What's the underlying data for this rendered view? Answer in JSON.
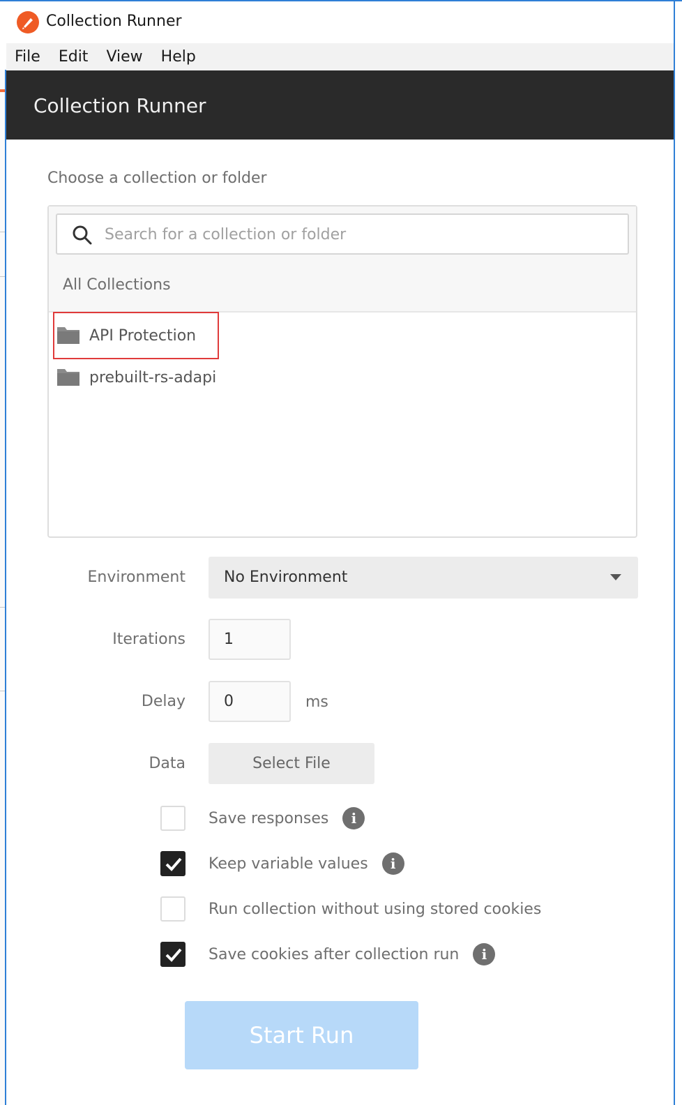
{
  "window": {
    "title": "Collection Runner",
    "icon": "postman-rocket-icon",
    "accent_color": "#ef5b25",
    "border_color": "#2f7fd6"
  },
  "menubar": {
    "items": [
      "File",
      "Edit",
      "View",
      "Help"
    ]
  },
  "header": {
    "title": "Collection Runner",
    "background": "#2a2a2a"
  },
  "chooser": {
    "label": "Choose a collection or folder",
    "search_placeholder": "Search for a collection or folder",
    "search_value": "",
    "group_label": "All Collections",
    "items": [
      {
        "label": "API Protection",
        "icon": "folder-icon",
        "highlighted": true
      },
      {
        "label": "prebuilt-rs-adapi",
        "icon": "folder-icon",
        "highlighted": false
      }
    ],
    "highlight_color": "#e03a3a"
  },
  "form": {
    "environment": {
      "label": "Environment",
      "value": "No Environment"
    },
    "iterations": {
      "label": "Iterations",
      "value": "1"
    },
    "delay": {
      "label": "Delay",
      "value": "0",
      "unit": "ms"
    },
    "data": {
      "label": "Data",
      "button": "Select File"
    }
  },
  "options": [
    {
      "label": "Save responses",
      "checked": false,
      "info": true
    },
    {
      "label": "Keep variable values",
      "checked": true,
      "info": true
    },
    {
      "label": "Run collection without using stored cookies",
      "checked": false,
      "info": false
    },
    {
      "label": "Save cookies after collection run",
      "checked": true,
      "info": true
    }
  ],
  "start_button": {
    "label": "Start Run",
    "color": "#b7d9f9"
  }
}
